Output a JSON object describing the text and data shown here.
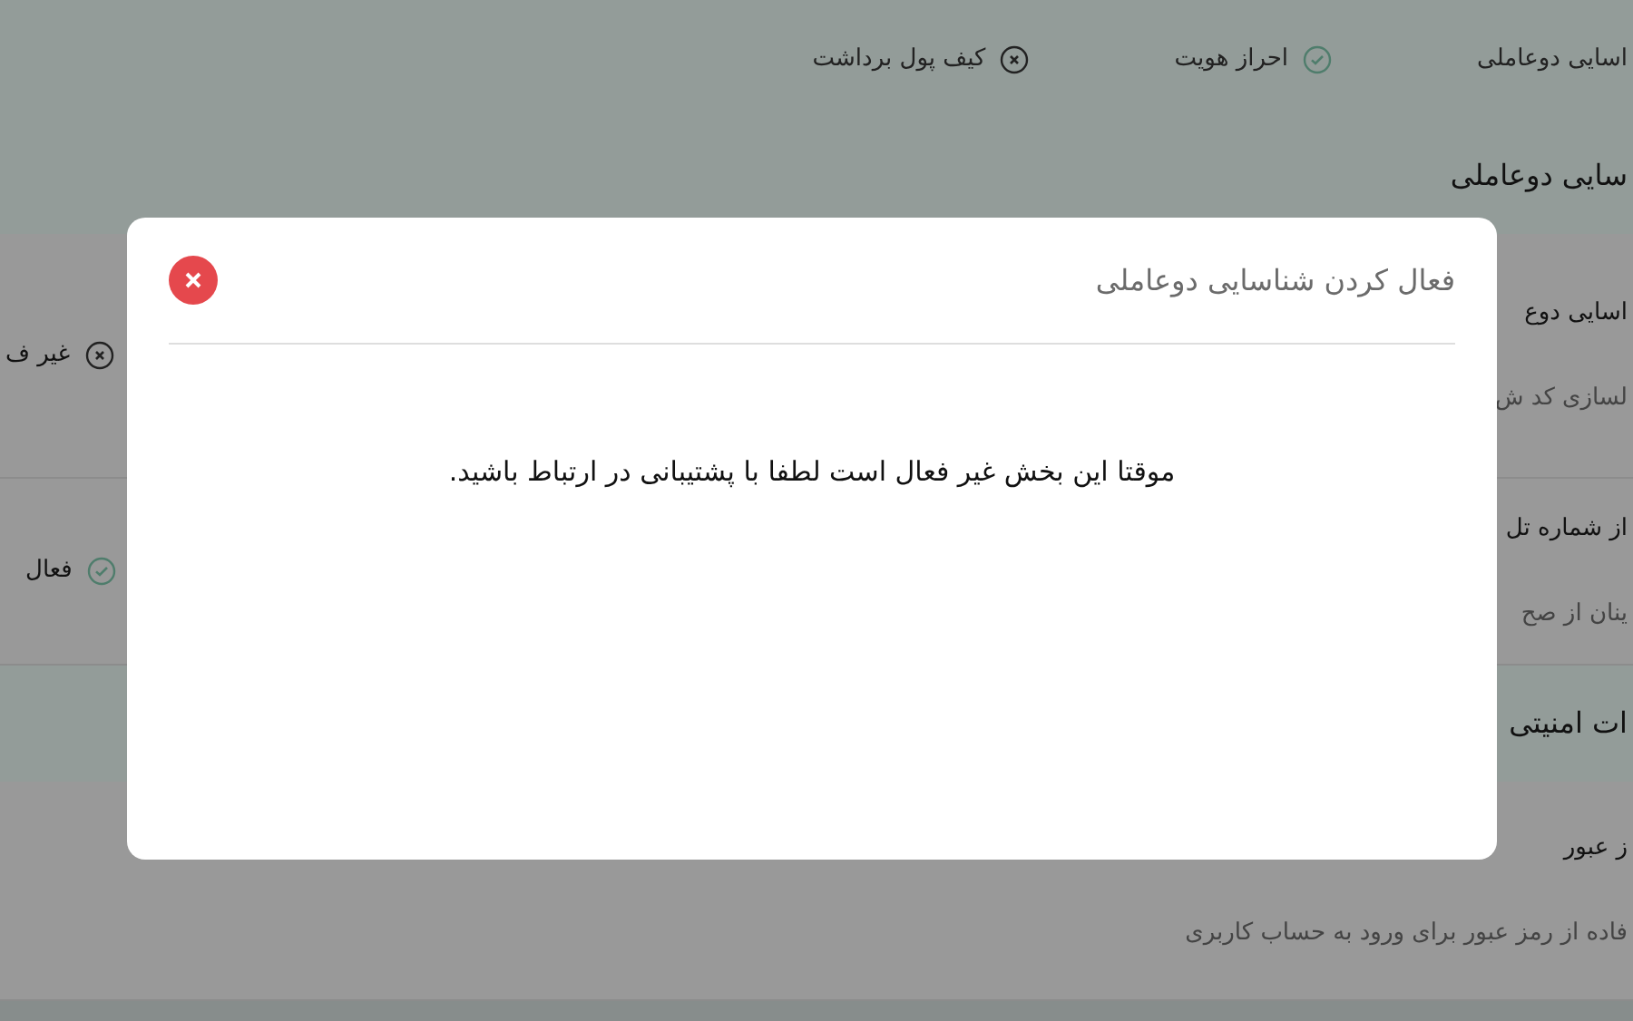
{
  "top_bar": {
    "items": [
      {
        "label": "اسایی دوعاملی"
      },
      {
        "label": "احراز هویت",
        "done": true
      },
      {
        "label": "کیف پول برداشت",
        "done": false
      }
    ]
  },
  "sections": [
    {
      "title": "سایی دوعاملی",
      "rows": [
        {
          "title": "اسایی دوع",
          "subtitle": "لسازی کد ش",
          "status_label": "غیر ف",
          "active": false
        },
        {
          "title": "از شماره تل",
          "subtitle": "ینان از صح",
          "status_label": "فعال",
          "active": true
        }
      ]
    },
    {
      "title": "ات امنیتی",
      "rows": [
        {
          "title": "ز عبور",
          "subtitle": "فاده از رمز عبور برای ورود به حساب کاربری"
        }
      ]
    }
  ],
  "dialog": {
    "title": "فعال کردن شناسایی دوعاملی",
    "message": "موقتا این بخش غیر فعال است لطفا با پشتیبانی در ارتباط باشید."
  }
}
